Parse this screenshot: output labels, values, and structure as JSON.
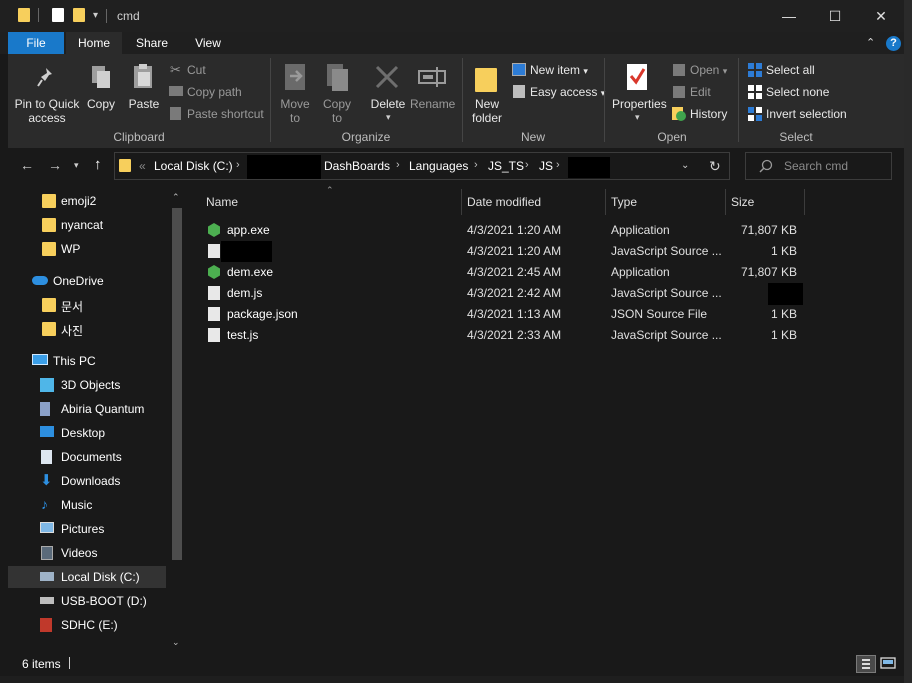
{
  "window": {
    "title": "cmd",
    "minimize": "—",
    "maximize": "☐",
    "close": "✕"
  },
  "ribbon_tabs": [
    "File",
    "Home",
    "Share",
    "View"
  ],
  "ribbon": {
    "clipboard": {
      "pin": "Pin to Quick access",
      "pin_l1": "Pin to Quick",
      "pin_l2": "access",
      "copy": "Copy",
      "paste": "Paste",
      "cut": "Cut",
      "copy_path": "Copy path",
      "paste_shortcut": "Paste shortcut",
      "label": "Clipboard"
    },
    "organize": {
      "move_to_l1": "Move",
      "move_to_l2": "to",
      "copy_to_l1": "Copy",
      "copy_to_l2": "to",
      "delete": "Delete",
      "rename": "Rename",
      "label": "Organize"
    },
    "new": {
      "new_folder_l1": "New",
      "new_folder_l2": "folder",
      "new_item": "New item",
      "easy_access": "Easy access",
      "label": "New"
    },
    "open": {
      "properties": "Properties",
      "open": "Open",
      "edit": "Edit",
      "history": "History",
      "label": "Open"
    },
    "select": {
      "select_all": "Select all",
      "select_none": "Select none",
      "invert": "Invert selection",
      "label": "Select"
    }
  },
  "address": {
    "breadcrumbs": [
      "Local Disk (C:)",
      "DashBoards",
      "Languages",
      "JS_TS",
      "JS"
    ],
    "search_placeholder": "Search cmd",
    "prefix": "«"
  },
  "nav": {
    "quick": [
      "emoji2",
      "nyancat",
      "WP"
    ],
    "onedrive": "OneDrive",
    "onedrive_items": [
      "문서",
      "사진"
    ],
    "this_pc": "This PC",
    "pc_items": [
      "3D Objects",
      "Abiria Quantum",
      "Desktop",
      "Documents",
      "Downloads",
      "Music",
      "Pictures",
      "Videos",
      "Local Disk (C:)",
      "USB-BOOT (D:)",
      "SDHC (E:)"
    ]
  },
  "columns": [
    "Name",
    "Date modified",
    "Type",
    "Size"
  ],
  "files": [
    {
      "name": "app.exe",
      "date": "4/3/2021 1:20 AM",
      "type": "Application",
      "size": "71,807 KB",
      "icon": "exe-icon"
    },
    {
      "name": "",
      "date": "4/3/2021 1:20 AM",
      "type": "JavaScript Source ...",
      "size": "1 KB",
      "icon": "js-icon"
    },
    {
      "name": "dem.exe",
      "date": "4/3/2021 2:45 AM",
      "type": "Application",
      "size": "71,807 KB",
      "icon": "exe-icon"
    },
    {
      "name": "dem.js",
      "date": "4/3/2021 2:42 AM",
      "type": "JavaScript Source ...",
      "size": "",
      "icon": "js-icon"
    },
    {
      "name": "package.json",
      "date": "4/3/2021 1:13 AM",
      "type": "JSON Source File",
      "size": "1 KB",
      "icon": "json-icon"
    },
    {
      "name": "test.js",
      "date": "4/3/2021 2:33 AM",
      "type": "JavaScript Source ...",
      "size": "1 KB",
      "icon": "js-icon"
    }
  ],
  "status": {
    "item_count": "6 items"
  },
  "colors": {
    "accent": "#1979ca",
    "folder": "#f7cf5c",
    "exe": "#4caf50"
  }
}
